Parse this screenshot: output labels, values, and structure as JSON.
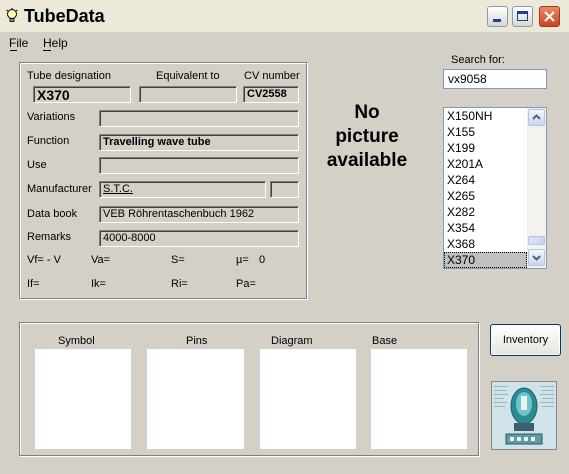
{
  "window": {
    "title": "TubeData"
  },
  "menu": [
    "File",
    "Help"
  ],
  "form": {
    "tube_designation_label": "Tube designation",
    "tube_designation": "X370",
    "equivalent_label": "Equivalent to",
    "equivalent": "",
    "cv_label": "CV number",
    "cv": "CV2558",
    "variations_label": "Variations",
    "variations": "",
    "function_label": "Function",
    "function": "Travelling wave tube",
    "use_label": "Use",
    "use": "",
    "manufacturer_label": "Manufacturer",
    "manufacturer": "S.T.C.",
    "manufacturer_extra": "",
    "databook_label": "Data book",
    "databook": "VEB Röhrentaschenbuch 1962",
    "remarks_label": "Remarks",
    "remarks": "4000-8000",
    "params_row1": {
      "vf": "Vf= - V",
      "va": "Va=",
      "s": "S=",
      "mu": "µ=",
      "mu_value": "0"
    },
    "params_row2": {
      "if": "If=",
      "ik": "Ik=",
      "ri": "Ri=",
      "pa": "Pa="
    }
  },
  "picture": {
    "message_line1": "No",
    "message_line2": "picture",
    "message_line3": "available"
  },
  "search": {
    "label": "Search for:",
    "value": "vx9058"
  },
  "tube_list": {
    "items": [
      "X150NH",
      "X155",
      "X199",
      "X201A",
      "X264",
      "X265",
      "X282",
      "X354",
      "X368",
      "X370"
    ],
    "selected": "X370"
  },
  "bottom_panels": {
    "symbol": "Symbol",
    "pins": "Pins",
    "diagram": "Diagram",
    "base": "Base"
  },
  "inventory_button": "Inventory",
  "colors": {
    "window_bg": "#d4d0c8",
    "close_button": "#c84523",
    "selection": "#c0c0c0"
  },
  "icons": {
    "app": "lightbulb-icon",
    "minimize": "minimize-icon",
    "maximize": "maximize-icon",
    "close": "close-icon"
  }
}
